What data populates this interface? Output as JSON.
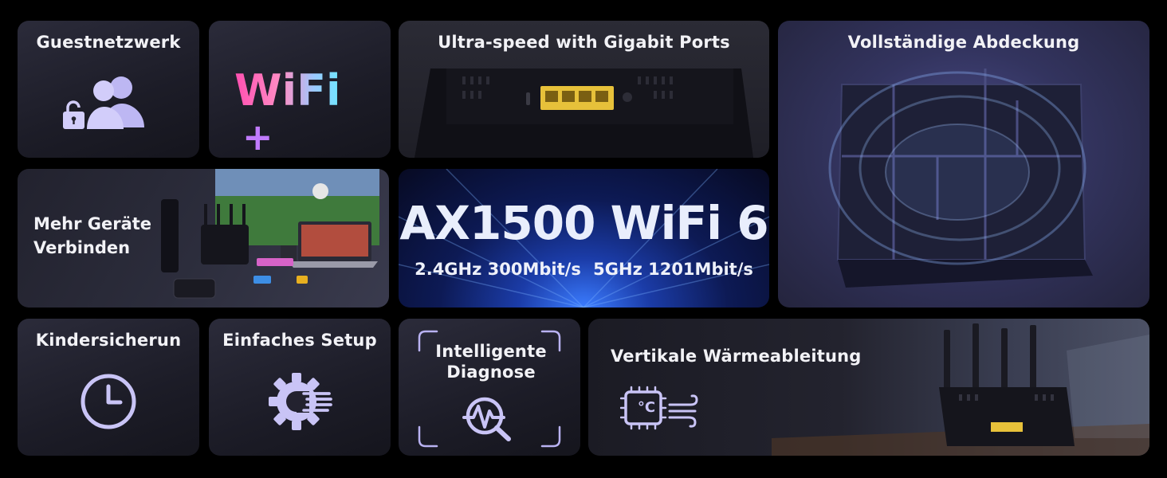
{
  "guest": {
    "title": "Guestnetzwerk"
  },
  "wifi_plus": {
    "text": "WiFi",
    "plus": "+"
  },
  "ports": {
    "title": "Ultra-speed with Gigabit Ports"
  },
  "coverage": {
    "title": "Vollständige Abdeckung"
  },
  "devices": {
    "line1": "Mehr Geräte",
    "line2": "Verbinden"
  },
  "ax": {
    "title": "AX1500 WiFi 6",
    "speed_24": "2.4GHz 300Mbit/s",
    "speed_5": "5GHz 1201Mbit/s"
  },
  "parental": {
    "title": "Kindersicherun"
  },
  "setup": {
    "title": "Einfaches Setup"
  },
  "diag": {
    "line1": "Intelligente",
    "line2": "Diagnose"
  },
  "heat": {
    "title": "Vertikale Wärmeableitung",
    "chip_text": "°C"
  },
  "colors": {
    "accent": "#b9b2f2",
    "icon_light": "#c9c4f6",
    "brand_pink": "#ff4fb0",
    "brand_cyan": "#6fe6ff",
    "plus": "#c07bff"
  }
}
